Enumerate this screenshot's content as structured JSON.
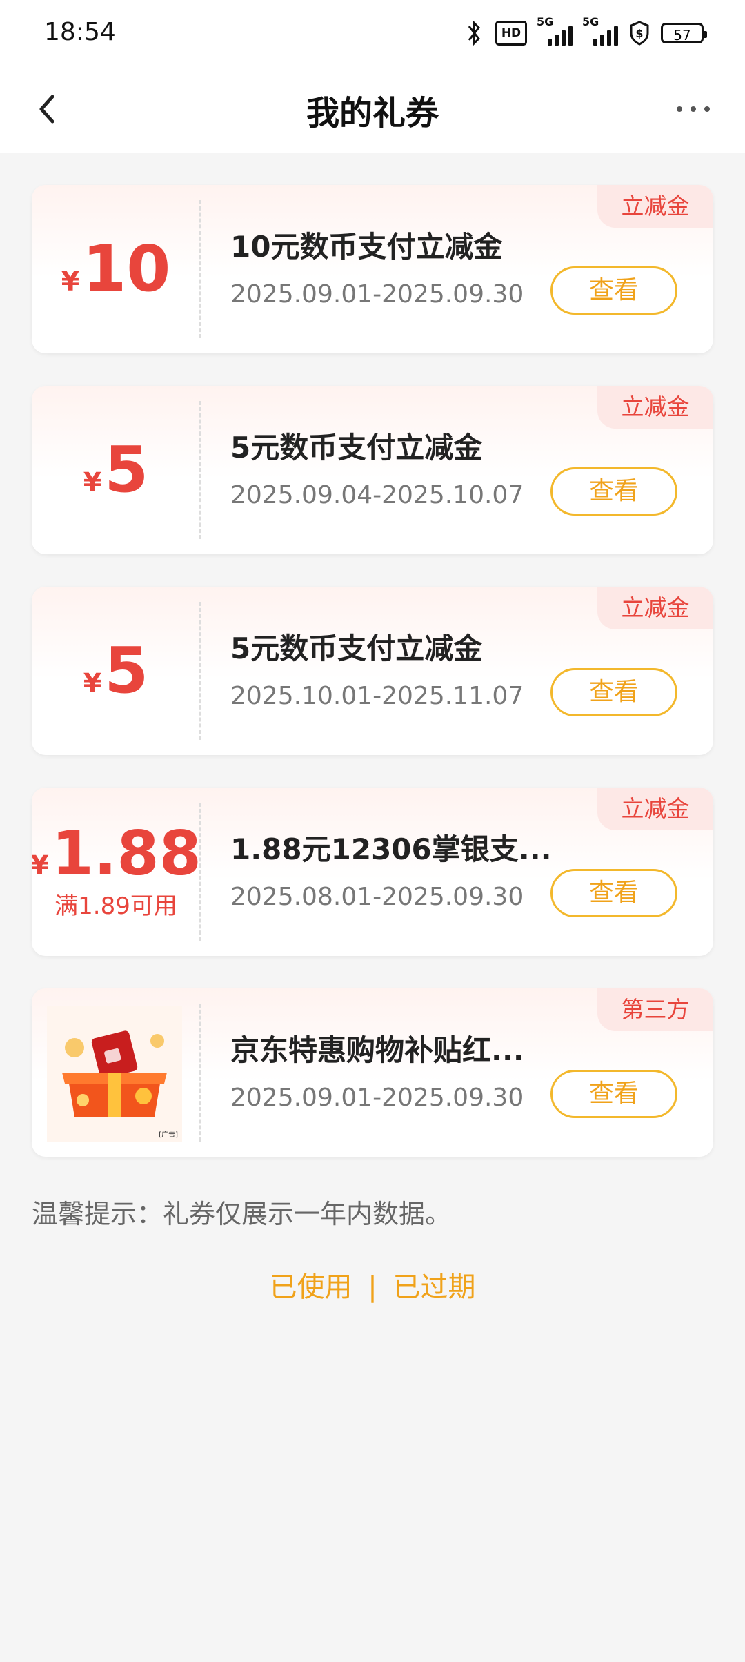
{
  "status": {
    "time": "18:54",
    "hd": "HD",
    "sim1": "5G",
    "sim2": "5G",
    "battery": "57"
  },
  "header": {
    "title": "我的礼券"
  },
  "coupons": [
    {
      "currency": "¥",
      "amount": "10",
      "condition": "",
      "title": "10元数币支付立减金",
      "date": "2025.09.01-2025.09.30",
      "tag": "立减金",
      "button": "查看"
    },
    {
      "currency": "¥",
      "amount": "5",
      "condition": "",
      "title": "5元数币支付立减金",
      "date": "2025.09.04-2025.10.07",
      "tag": "立减金",
      "button": "查看"
    },
    {
      "currency": "¥",
      "amount": "5",
      "condition": "",
      "title": "5元数币支付立减金",
      "date": "2025.10.01-2025.11.07",
      "tag": "立减金",
      "button": "查看"
    },
    {
      "currency": "¥",
      "amount": "1.88",
      "condition": "满1.89可用",
      "title": "1.88元12306掌银支...",
      "date": "2025.08.01-2025.09.30",
      "tag": "立减金",
      "button": "查看"
    },
    {
      "title": "京东特惠购物补贴红...",
      "date": "2025.09.01-2025.09.30",
      "tag": "第三方",
      "button": "查看",
      "image_label": "[广告]"
    }
  ],
  "tip": "温馨提示：礼券仅展示一年内数据。",
  "links": {
    "used": "已使用",
    "separator": "|",
    "expired": "已过期"
  },
  "colors": {
    "accent_red": "#e8453c",
    "accent_orange": "#f0a21a",
    "background": "#f5f5f5"
  }
}
